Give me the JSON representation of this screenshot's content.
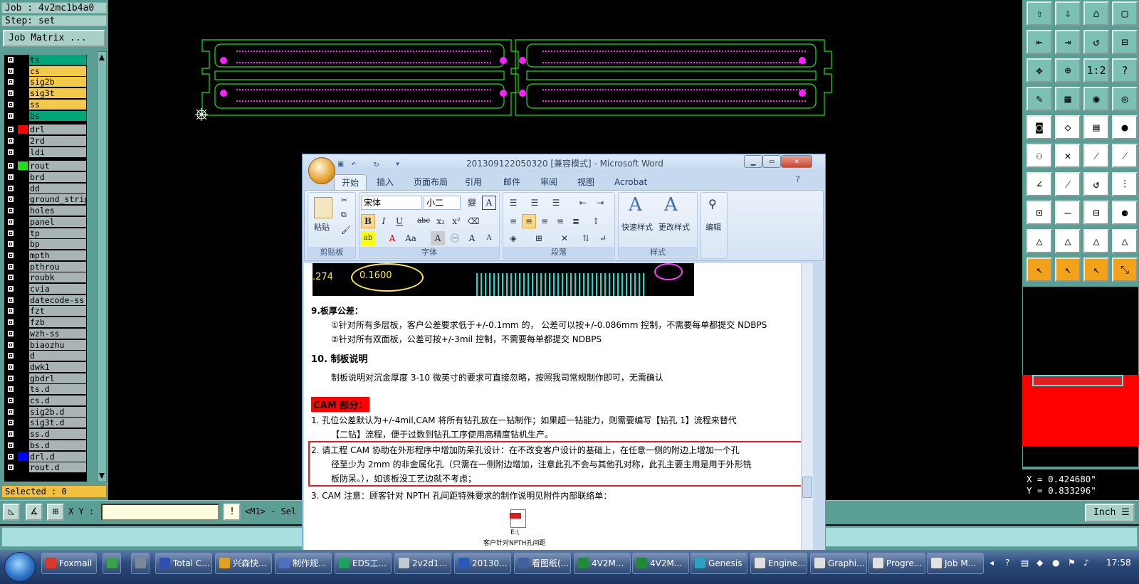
{
  "job": {
    "job_label": "Job : 4v2mc1b4a0",
    "step_label": "Step: set",
    "matrix_button": "Job Matrix ..."
  },
  "layers": [
    {
      "name": "ts",
      "color": "#00a57a",
      "mark": ""
    },
    {
      "name": "cs",
      "color": "#f2c94a",
      "mark": ""
    },
    {
      "name": "sig2b",
      "color": "#f2c94a",
      "mark": ""
    },
    {
      "name": "sig3t",
      "color": "#f2c94a",
      "mark": ""
    },
    {
      "name": "ss",
      "color": "#f2c94a",
      "mark": ""
    },
    {
      "name": "bs",
      "color": "#00a57a",
      "mark": ""
    },
    {
      "name": "drl",
      "color": "#a8b4b4",
      "mark": "⊞"
    },
    {
      "name": "2rd",
      "color": "#a8b4b4",
      "mark": ""
    },
    {
      "name": "ldi",
      "color": "#a8b4b4",
      "mark": ""
    },
    {
      "name": "rout",
      "color": "#a8b4b4",
      "mark": ""
    },
    {
      "name": "brd",
      "color": "#a8b4b4",
      "mark": ""
    },
    {
      "name": "dd",
      "color": "#a8b4b4",
      "mark": ""
    },
    {
      "name": "ground_strip",
      "color": "#a8b4b4",
      "mark": ""
    },
    {
      "name": "holes",
      "color": "#a8b4b4",
      "mark": ""
    },
    {
      "name": "panel",
      "color": "#a8b4b4",
      "mark": ""
    },
    {
      "name": "tp",
      "color": "#a8b4b4",
      "mark": ""
    },
    {
      "name": "bp",
      "color": "#a8b4b4",
      "mark": ""
    },
    {
      "name": "mpth",
      "color": "#a8b4b4",
      "mark": ""
    },
    {
      "name": "pthrou",
      "color": "#a8b4b4",
      "mark": ""
    },
    {
      "name": "roubk",
      "color": "#a8b4b4",
      "mark": ""
    },
    {
      "name": "cvia",
      "color": "#a8b4b4",
      "mark": ""
    },
    {
      "name": "datecode-ss",
      "color": "#a8b4b4",
      "mark": ""
    },
    {
      "name": "fzt",
      "color": "#a8b4b4",
      "mark": ""
    },
    {
      "name": "fzb",
      "color": "#a8b4b4",
      "mark": ""
    },
    {
      "name": "wzh-ss",
      "color": "#a8b4b4",
      "mark": ""
    },
    {
      "name": "biaozhu",
      "color": "#a8b4b4",
      "mark": ""
    },
    {
      "name": "d",
      "color": "#a8b4b4",
      "mark": ""
    },
    {
      "name": "dwk1",
      "color": "#a8b4b4",
      "mark": ""
    },
    {
      "name": "gbdrl",
      "color": "#a8b4b4",
      "mark": ""
    },
    {
      "name": "ts.d",
      "color": "#a8b4b4",
      "mark": "✎"
    },
    {
      "name": "cs.d",
      "color": "#a8b4b4",
      "mark": ""
    },
    {
      "name": "sig2b.d",
      "color": "#a8b4b4",
      "mark": ""
    },
    {
      "name": "sig3t.d",
      "color": "#a8b4b4",
      "mark": ""
    },
    {
      "name": "ss.d",
      "color": "#a8b4b4",
      "mark": ""
    },
    {
      "name": "bs.d",
      "color": "#a8b4b4",
      "mark": "✎"
    },
    {
      "name": "drl.d",
      "color": "#a8b4b4",
      "mark": ""
    },
    {
      "name": "rout.d",
      "color": "#a8b4b4",
      "mark": ""
    }
  ],
  "selected_label": "Selected : 0",
  "cmd": {
    "xy_label": "X Y :",
    "input_value": "",
    "message": "<M1> - Sel",
    "units": "Inch"
  },
  "coords": {
    "x": "X = 0.424680\"",
    "y": "Y = 0.833296\""
  },
  "word": {
    "title": "201309122050320 [兼容模式] - Microsoft Word",
    "tabs": [
      "开始",
      "插入",
      "页面布局",
      "引用",
      "邮件",
      "审阅",
      "视图",
      "Acrobat"
    ],
    "groups": {
      "clipboard": "剪贴板",
      "font": "字体",
      "paragraph": "段落",
      "styles": "样式",
      "paste": "粘贴",
      "quick_style": "快速样式",
      "change_style": "更改样式",
      "edit": "编辑"
    },
    "font_name": "宋体",
    "font_size": "小二",
    "img_labels": {
      "a": ".274",
      "b": "0.1600"
    },
    "lines": {
      "h9": "9.板厚公差：",
      "l9a": "①针对所有多层板，客户公差要求低于+/-0.1mm 的， 公差可以按+/-0.086mm 控制，不需要每单都提交 NDBPS",
      "l9b": "②针对所有双面板，公差可按+/-3mil 控制，不需要每单都提交 NDBPS",
      "h10": "10.  制板说明",
      "l10": "制板说明对沉金厚度 3-10 微英寸的要求可直接忽略，按照我司常规制作即可，无需确认",
      "cam": "CAM 部分：",
      "c1a": "1.   孔位公差默认为+/-4mil,CAM 将所有钻孔放在一钻制作；如果超一钻能力，则需要编写【钻孔 1】流程来替代",
      "c1b": "【二钻】流程，便于过数到钻孔工序使用高精度钻机生产。",
      "c2a": "2.   请工程 CAM 协助在外形程序中增加防呆孔设计：在不改变客户设计的基础上，在任意一侧的附边上增加一个孔",
      "c2b": "径至少为 2mm 的非金属化孔（只需在一侧附边增加，注意此孔不会与其他孔对称，此孔主要主用是用于外形铣",
      "c2c": "板防呆。），如该板没工艺边就不考虑；",
      "c3": "3.   CAM 注意：顾客针对 NPTH 孔间距特殊要求的制作说明见附件内部联络单：",
      "att_path": "E:\\",
      "att_name": "客户针对NPTH孔间距"
    }
  },
  "taskbar": {
    "items": [
      {
        "label": "Foxmail",
        "color": "#d83a2a"
      },
      {
        "label": "",
        "color": "#3aa04a"
      },
      {
        "label": "",
        "color": "#7a8a9a"
      },
      {
        "label": "Total C...",
        "color": "#3050b0"
      },
      {
        "label": "兴森快...",
        "color": "#e0a020"
      },
      {
        "label": "制作规...",
        "color": "#5070c0"
      },
      {
        "label": "EDS工...",
        "color": "#20a060"
      },
      {
        "label": "2v2d1...",
        "color": "#c0c8d0"
      },
      {
        "label": "20130...",
        "color": "#2a5ab8"
      },
      {
        "label": "看图纸(...",
        "color": "#4060a0"
      },
      {
        "label": "4V2M...",
        "color": "#1e8a3a"
      },
      {
        "label": "4V2M...",
        "color": "#1e8a3a"
      },
      {
        "label": "Genesis",
        "color": "#30a0c0"
      },
      {
        "label": "Engine...",
        "color": "#e0e0e0"
      },
      {
        "label": "Graphi...",
        "color": "#e0e0e0"
      },
      {
        "label": "Progre...",
        "color": "#e0e0e0"
      },
      {
        "label": "Job M...",
        "color": "#e0e0e0"
      }
    ],
    "clock": "17:58"
  }
}
